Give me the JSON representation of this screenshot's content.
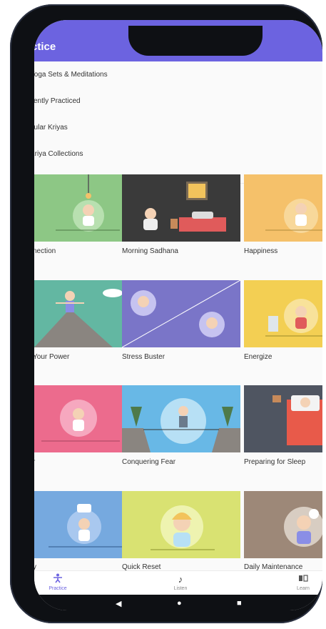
{
  "appbar": {
    "title": "ctice"
  },
  "menu": [
    "Yoga Sets & Meditations",
    "cently Practiced",
    "pular Kriyas",
    "Kriya Collections"
  ],
  "cards": [
    {
      "label": "nection",
      "bg": "#8dc785"
    },
    {
      "label": "Morning Sadhana",
      "bg": "#3a3a3a"
    },
    {
      "label": "Happiness",
      "bg": "#f5c16a"
    },
    {
      "label": "Your Power",
      "bg": "#63b7a2"
    },
    {
      "label": "Stress Buster",
      "bg": "#7a75c8"
    },
    {
      "label": "Energize",
      "bg": "#f3cf53"
    },
    {
      "label": "r",
      "bg": "#ec6b8d"
    },
    {
      "label": "Conquering Fear",
      "bg": "#68b8e6"
    },
    {
      "label": "Preparing for Sleep",
      "bg": "#4f5561"
    },
    {
      "label": "y",
      "bg": "#76a9df"
    },
    {
      "label": "Quick Reset",
      "bg": "#d9e272"
    },
    {
      "label": "Daily Maintenance",
      "bg": "#9d8878"
    }
  ],
  "bottom_nav": [
    {
      "label": "Practice",
      "icon": "person-pose-icon"
    },
    {
      "label": "Listen",
      "icon": "music-note-icon"
    },
    {
      "label": "Learn",
      "icon": "book-icon"
    }
  ],
  "system_bar": {
    "back": "◀",
    "home": "●",
    "recents": "■"
  },
  "colors": {
    "accent": "#6c63e0"
  }
}
